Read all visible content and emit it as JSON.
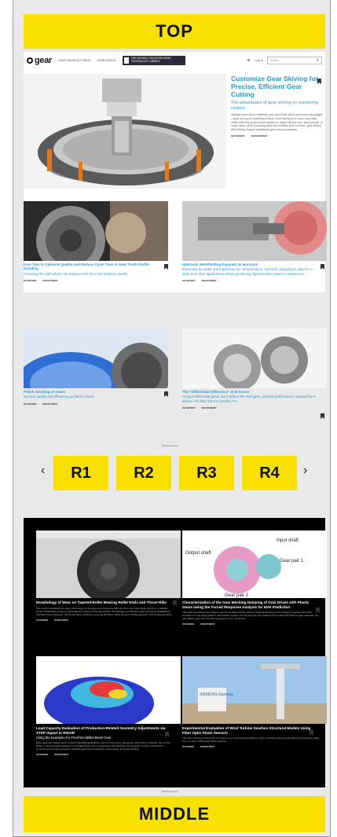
{
  "banners": {
    "top": "TOP",
    "middle": "MIDDLE"
  },
  "nav": {
    "logo": "gear",
    "links": [
      "GEAR MANUFACTURING",
      "GEAR DESIGN"
    ],
    "library": "THE MICHAEL GOLDSTEIN GEAR TECHNOLOGY LIBRARY",
    "menu_icon": "hamburger-icon",
    "login": "Log In",
    "search_placeholder": "Search..."
  },
  "hero": {
    "title": "Customize Gear Skiving for Precise, Efficient Gear Cutting",
    "subtitle": "The advantages of gear skiving on machining centers",
    "body": "Manufacturers have a relatively new option that offers several key advantages—gear skiving on machining centers. Gear skiving on a 5-axis machining center with fully synchronized spindles is highly efficient, fast, and accurate. In some cases, when producing small and medium-sized volumes, gear skiving will probably replace established gear-cutting processes.",
    "tags": [
      "KEYWORDS",
      "DEPARTMENT"
    ]
  },
  "cards": [
    {
      "title": "Four Tips to Optimize Quality and Reduce Cycle Time in Gear Tooth Profile Grinding",
      "subtitle": "Choosing the right wheel can reduce cycle time and optimize quality.",
      "tags": [
        "KEYWORDS",
        "DEPARTMENT"
      ]
    },
    {
      "title": "Hydraulic Workholding Expands Its Horizons",
      "subtitle": "Extremely accurate and impervious to contamination, hydraulic clamping is ideal for e-drive and other applications where producing high-precision gears is paramount.",
      "tags": [
        "KEYWORDS",
        "DEPARTMENT"
      ]
    },
    {
      "title": "Polish Grinding of Gears",
      "subtitle": "Surface quality and efficiency go hand in hand",
      "tags": [
        "KEYWORDS",
        "DEPARTMENT"
      ]
    },
    {
      "title": "The \"Differential Difference\" in E-Drives",
      "subtitle": "Forged differential gears don't deliver the strongest, quietest performance required by e-drives—for that, there's Coniflex Pro",
      "tags": [
        "KEYWORDS",
        "DEPARTMENT"
      ]
    }
  ],
  "ad_label": "[advertisement]",
  "carousel": {
    "prev": "‹",
    "next": "›",
    "slots": [
      "R1",
      "R2",
      "R3",
      "R4"
    ]
  },
  "dark_cards": [
    {
      "title": "Morphology of Wear on Tapered-Roller Bearing Roller Ends and Thrust Ribs",
      "body": "This report investigates the wear morphology on the large end of tapered rollers and the inner ring's large end rib on a plateau-sense. Additionally, it uses a multi-magnetic contact surface geometries. The literature on abrasive wear has many classifications, including closely abrasion, 3-body abrasion, scratches, grooving abrasion, rolling abrasion, cutting abrasion, and plowing abrasion.",
      "tags": [
        "KEYWORDS",
        "DEPARTMENT"
      ]
    },
    {
      "title": "Characterization of the Gear Meshing Damping of Gear Drives with Plastic Gears Using the Forced Response Analysis for NVH Prediction",
      "body": "This paper presented some steps to get more insight into the effect of meshing damping on the dynamic response and noise emission of a two-stage gearbox transmission system. For this purpose, two variants of the model with different gear materials, one with plastic gears and one with steel gears, were considered.",
      "tags": [
        "KEYWORDS",
        "DEPARTMENT"
      ],
      "labels": [
        "Input shaft",
        "Output shaft",
        "Gear pair 1",
        "Gear pair 2"
      ]
    },
    {
      "title": "Load Capacity Evaluation of Production-Related Geometry Adjustments via STEP Import in RIKOR",
      "subtitle": "Using the Example of a Freeform Milled Bevel Gear",
      "body": "Bevel gears are widely used in various industrial applications, such as automotive, aerospace, and marine industries, due to their ability to transmit power between non-parallel shafts. The conventional manufacturing of bevel gears involves several time-consuming and costly processes, including gear blank preparation, gear cutting, and gear finishing.",
      "tags": [
        "KEYWORDS",
        "DEPARTMENT"
      ]
    },
    {
      "title": "Experimental Evaluation of Wind Turbine Gearbox Structural Models Using Fiber Optic Strain Sensors",
      "body": "The main objective of this study is to perform an experimental evaluation of the structural model of a five-planet first planetary stage from a modern 6MW wind turbine gearbox.",
      "tags": [
        "KEYWORDS",
        "DEPARTMENT"
      ],
      "labels": [
        "SIEMENS Gamesa"
      ]
    }
  ],
  "colors": {
    "banner": "#f8e100",
    "link": "#1c9bd7",
    "dark_bg": "#000000"
  }
}
